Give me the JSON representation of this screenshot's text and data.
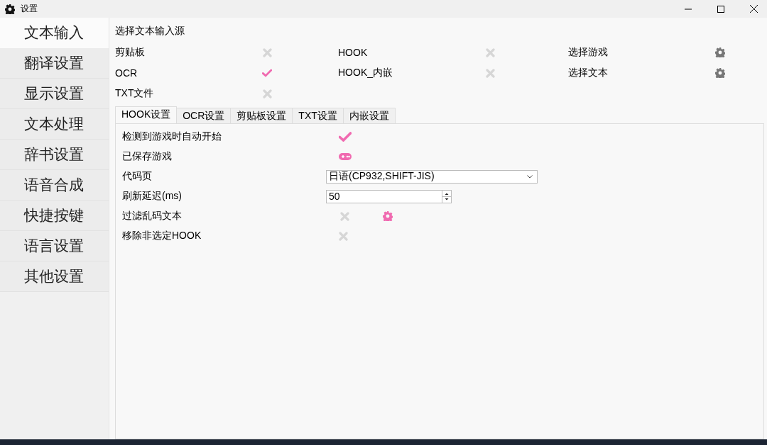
{
  "window": {
    "title": "设置"
  },
  "sidebar": {
    "items": [
      {
        "label": "文本输入",
        "selected": true
      },
      {
        "label": "翻译设置",
        "selected": false
      },
      {
        "label": "显示设置",
        "selected": false
      },
      {
        "label": "文本处理",
        "selected": false
      },
      {
        "label": "辞书设置",
        "selected": false
      },
      {
        "label": "语音合成",
        "selected": false
      },
      {
        "label": "快捷按键",
        "selected": false
      },
      {
        "label": "语言设置",
        "selected": false
      },
      {
        "label": "其他设置",
        "selected": false
      }
    ]
  },
  "sources": {
    "title": "选择文本输入源",
    "items": [
      {
        "label": "剪贴板",
        "kind": "toggle",
        "checked": false
      },
      {
        "label": "HOOK",
        "kind": "toggle",
        "checked": false
      },
      {
        "label": "选择游戏",
        "kind": "settings"
      },
      {
        "label": "OCR",
        "kind": "toggle",
        "checked": true
      },
      {
        "label": "HOOK_内嵌",
        "kind": "toggle",
        "checked": false
      },
      {
        "label": "选择文本",
        "kind": "settings"
      },
      {
        "label": "TXT文件",
        "kind": "toggle",
        "checked": false
      }
    ]
  },
  "tabs": [
    {
      "label": "HOOK设置",
      "selected": true
    },
    {
      "label": "OCR设置",
      "selected": false
    },
    {
      "label": "剪贴板设置",
      "selected": false
    },
    {
      "label": "TXT设置",
      "selected": false
    },
    {
      "label": "内嵌设置",
      "selected": false
    }
  ],
  "hook_settings": [
    {
      "label": "检测到游戏时自动开始",
      "kind": "toggle",
      "checked": true
    },
    {
      "label": "已保存游戏",
      "kind": "games"
    },
    {
      "label": "代码页",
      "kind": "select",
      "value": "日语(CP932,SHIFT-JIS)"
    },
    {
      "label": "刷新延迟(ms)",
      "kind": "spin",
      "value": "50"
    },
    {
      "label": "过滤乱码文本",
      "kind": "toggle_settings",
      "checked": false
    },
    {
      "label": "移除非选定HOOK",
      "kind": "toggle",
      "checked": false
    }
  ]
}
